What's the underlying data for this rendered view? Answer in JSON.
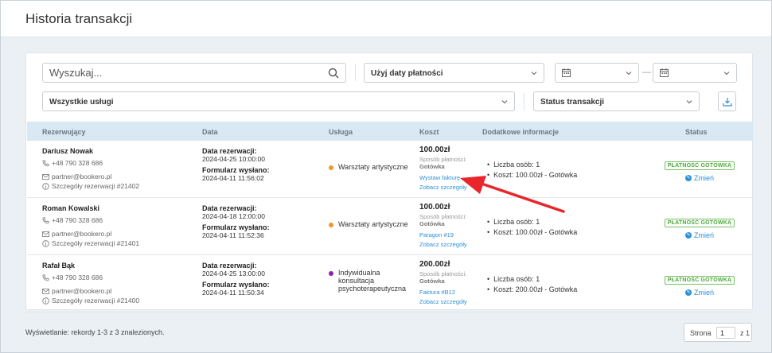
{
  "header": {
    "title": "Historia transakcji"
  },
  "filters": {
    "search_placeholder": "Wyszukaj...",
    "date_mode": "Użyj daty płatności",
    "date_from": "",
    "date_to": "",
    "date_separator": "—",
    "services": "Wszystkie usługi",
    "status": "Status transakcji"
  },
  "table": {
    "columns": [
      "Rezerwujący",
      "Data",
      "Usługa",
      "Koszt",
      "Dodatkowe informacje",
      "Status"
    ],
    "rows": [
      {
        "name": "Dariusz Nowak",
        "phone": "+48 790 328 686",
        "email": "partner@bookero.pl",
        "details": "Szczegóły rezerwacji #21402",
        "date_label": "Data rezerwacji:",
        "date_value": "2024-04-25 10:00:00",
        "form_label": "Formularz wysłano:",
        "form_value": "2024-04-11 11:56:02",
        "service": "Warsztaty artystyczne",
        "service_color": "#f0962c",
        "price": "100.00zł",
        "payment_label": "Sposób płatności:",
        "payment_value": "Gotówka",
        "link1": "Wystaw fakturę",
        "link2": "Zobacz szczegóły",
        "info": [
          "Liczba osób: 1",
          "Koszt: 100.00zł - Gotówka"
        ],
        "status": "PŁATNOŚĆ GOTÓWKĄ",
        "change": "Zmień"
      },
      {
        "name": "Roman Kowalski",
        "phone": "+48 790 328 686",
        "email": "partner@bookero.pl",
        "details": "Szczegóły rezerwacji #21401",
        "date_label": "Data rezerwacji:",
        "date_value": "2024-04-18 12:00:00",
        "form_label": "Formularz wysłano:",
        "form_value": "2024-04-11 11:52:36",
        "service": "Warsztaty artystyczne",
        "service_color": "#f0962c",
        "price": "100.00zł",
        "payment_label": "Sposób płatności:",
        "payment_value": "Gotówka",
        "link1": "Paragon #19",
        "link2": "Zobacz szczegóły",
        "info": [
          "Liczba osób: 1",
          "Koszt: 100.00zł - Gotówka"
        ],
        "status": "PŁATNOŚĆ GOTÓWKĄ",
        "change": "Zmień"
      },
      {
        "name": "Rafał Bąk",
        "phone": "+48 790 328 686",
        "email": "partner@bookero.pl",
        "details": "Szczegóły rezerwacji #21400",
        "date_label": "Data rezerwacji:",
        "date_value": "2024-04-25 13:00:00",
        "form_label": "Formularz wysłano:",
        "form_value": "2024-04-11 11:50:34",
        "service": "Indywidualna konsultacja psychoterapeutyczna",
        "service_color": "#8e1fb0",
        "price": "200.00zł",
        "payment_label": "Sposób płatności:",
        "payment_value": "Gotówka",
        "link1": "Faktura #B12",
        "link2": "Zobacz szczegóły",
        "info": [
          "Liczba osób: 1",
          "Koszt: 200.00zł - Gotówka"
        ],
        "status": "PŁATNOŚĆ GOTÓWKĄ",
        "change": "Zmień"
      }
    ]
  },
  "footer": {
    "records": "Wyświetlanie: rekordy 1-3 z 3 znalezionych.",
    "page_label": "Strona",
    "page_value": "1",
    "page_total": "z 1"
  },
  "icons": {
    "search": "search-icon",
    "chevron": "chevron-down-icon",
    "calendar": "calendar-icon",
    "download": "download-icon",
    "phone": "phone-icon",
    "email": "envelope-icon",
    "info": "info-icon",
    "change": "edit-icon",
    "arrow": "red-arrow-annotation"
  },
  "colors": {
    "accent": "#2d8fd5",
    "status_green": "#4ca83a",
    "arrow": "#e8262b"
  }
}
